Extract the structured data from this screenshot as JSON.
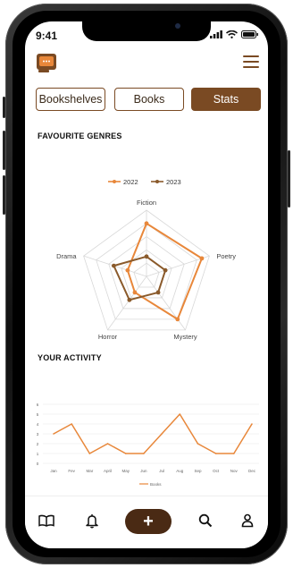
{
  "status": {
    "time": "9:41"
  },
  "header": {
    "logo_icon": "book-chat-icon",
    "menu_icon": "hamburger-icon"
  },
  "tabs": [
    {
      "label": "Bookshelves",
      "active": false
    },
    {
      "label": "Books",
      "active": false
    },
    {
      "label": "Stats",
      "active": true
    }
  ],
  "favourite_genres": {
    "title": "FAVOURITE GENRES",
    "legend": [
      "2022",
      "2023"
    ]
  },
  "your_activity": {
    "title": "YOUR ACTIVITY"
  },
  "colors": {
    "accent": "#7a4a23",
    "series_2022": "#e8873a",
    "series_2023": "#8a5a2b",
    "fab": "#4a2a14"
  },
  "chart_data": [
    {
      "type": "radar",
      "title": "FAVOURITE GENRES",
      "categories": [
        "Fiction",
        "Poetry",
        "Mystery",
        "Horror",
        "Drama"
      ],
      "range": [
        0,
        5
      ],
      "series": [
        {
          "name": "2022",
          "values": [
            4,
            4.4,
            4,
            1.5,
            1.5
          ]
        },
        {
          "name": "2023",
          "values": [
            1.5,
            1.5,
            1.5,
            2.2,
            2.6
          ]
        }
      ],
      "legend": "top"
    },
    {
      "type": "line",
      "title": "YOUR ACTIVITY",
      "categories": [
        "Jan",
        "Fev",
        "Mar",
        "April",
        "May",
        "Jun",
        "Jul",
        "Aug",
        "Sep",
        "Oct",
        "Nov",
        "Dec"
      ],
      "series": [
        {
          "name": "Books",
          "values": [
            3,
            4,
            1,
            2,
            1,
            1,
            3,
            5,
            2,
            1,
            1,
            4
          ]
        }
      ],
      "ylim": [
        0,
        6
      ],
      "yticks": [
        0,
        1,
        2,
        3,
        4,
        5,
        6
      ],
      "grid": true,
      "legend": "bottom"
    }
  ],
  "bottom_nav": {
    "items": [
      "book-open-icon",
      "bell-icon",
      "add-icon",
      "search-icon",
      "profile-icon"
    ],
    "fab_label": "+"
  }
}
